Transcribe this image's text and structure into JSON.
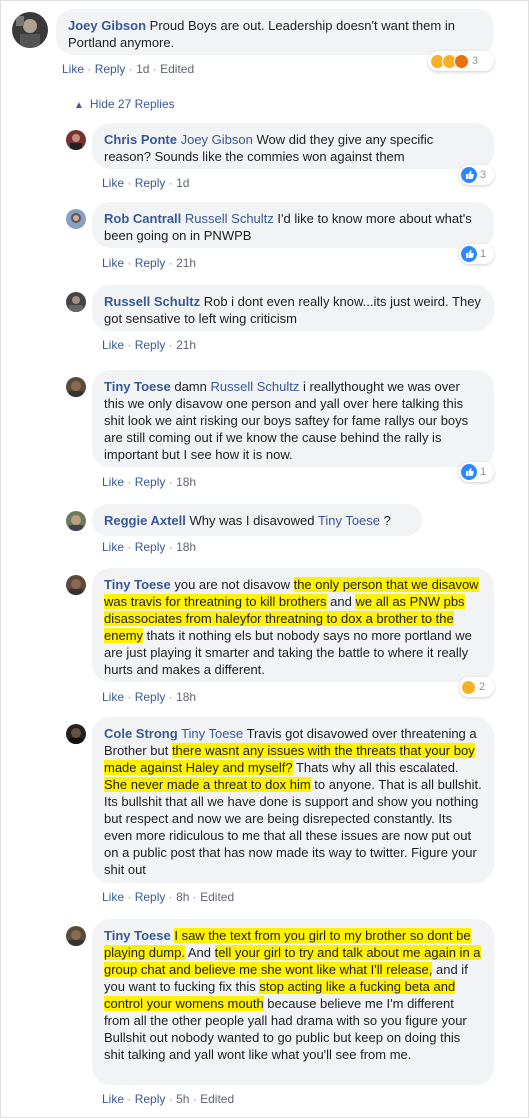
{
  "actions": {
    "like": "Like",
    "reply": "Reply",
    "edited": "Edited",
    "sep": "·"
  },
  "root": {
    "author": "Joey Gibson",
    "text": "Proud Boys are out. Leadership doesn't want them in Portland anymore.",
    "time": "1d",
    "reaction_count": "3",
    "reactions": [
      "wow",
      "sad",
      "angry"
    ]
  },
  "hide_replies": "Hide 27 Replies",
  "replies": [
    {
      "author": "Chris Ponte",
      "mention": "Joey Gibson",
      "text": " Wow did they give any specific reason? Sounds like the commies won against them",
      "time": "1d",
      "reaction_count": "3",
      "reaction": "like"
    },
    {
      "author": "Rob Cantrall",
      "mention": "Russell Schultz",
      "text": " I'd like to know more about what's been going on in PNWPB",
      "time": "21h",
      "reaction_count": "1",
      "reaction": "like"
    },
    {
      "author": "Russell Schultz",
      "text": "Rob i dont even really know...its just weird. They got sensative to left wing criticism",
      "time": "21h"
    },
    {
      "author": "Tiny Toese",
      "pre": "damn ",
      "mention": "Russell Schultz",
      "text": " i reallythought we was over this we only disavow one person and yall over here talking this shit look we aint risking our boys saftey for fame rallys our boys are still coming out if we know the cause behind the rally is important but I see how it is now.",
      "time": "18h",
      "reaction_count": "1",
      "reaction": "like"
    },
    {
      "author": "Reggie Axtell",
      "pre": "Why was I disavowed ",
      "mention": "Tiny Toese",
      "text": " ?",
      "time": "18h"
    },
    {
      "author": "Tiny Toese",
      "t1": "you are not disavow ",
      "h1": "the only person that we disavow was travis for threatning to kill brothers",
      "t2": " and ",
      "h2": "we all as PNW pbs disassociates from haleyfor threatning to dox a brother to the enemy",
      "t3": " thats it nothing els but nobody says no more portland we are just playing it smarter and taking the battle to where it really hurts and makes a different.",
      "time": "18h",
      "reaction_count": "2",
      "reaction": "wow"
    },
    {
      "author": "Cole Strong",
      "mention": "Tiny Toese",
      "t1": " Travis got disavowed over threatening a Brother but ",
      "h1": "there wasnt any issues with the threats that your boy made against Haley and myself?",
      "t2": " Thats why all this escalated. ",
      "h2": "She never made a threat to dox him",
      "t3": " to anyone. That is all bullshit. Its bullshit that all we have done is support and show you nothing but respect and now we are being disrepected constantly. Its even more ridiculous to me that all these issues are now put out on a public post that has now made its way to twitter. Figure your shit out",
      "time": "8h"
    },
    {
      "author": "Tiny Toese",
      "h1": "I saw the text from you girl to my brother so dont be playing dump.",
      "t1": " And ",
      "h2": "tell your girl to try and talk about me again in a group chat and believe me she wont like what I'll release,",
      "t2": " and if you want to fucking fix this ",
      "h3": "stop acting like a fucking beta and control your womens mouth",
      "t3": " because believe me I'm different from all the other people yall had drama with so you figure your Bullshit out nobody wanted to go public but keep on doing this shit talking and yall wont like what you'll see from me.",
      "time": "5h"
    }
  ]
}
